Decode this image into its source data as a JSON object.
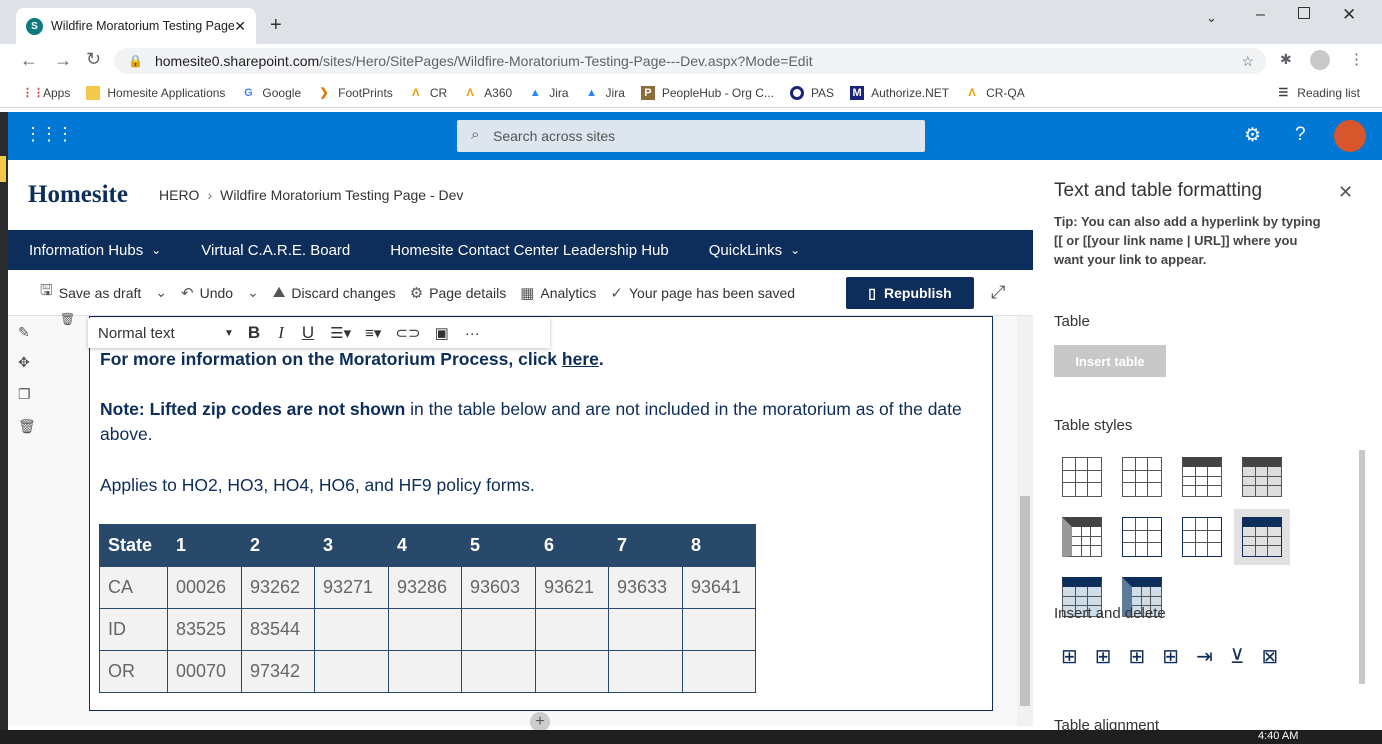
{
  "browser": {
    "tab_title": "Wildfire Moratorium Testing Page",
    "url_host": "homesite0.sharepoint.com",
    "url_path": "/sites/Hero/SitePages/Wildfire-Moratorium-Testing-Page---Dev.aspx?Mode=Edit"
  },
  "bookmarks": [
    "Apps",
    "Homesite Applications",
    "Google",
    "FootPrints",
    "CR",
    "A360",
    "Jira",
    "Jira",
    "PeopleHub - Org C...",
    "PAS",
    "Authorize.NET",
    "CR-QA"
  ],
  "reading_list": "Reading list",
  "suite": {
    "search_placeholder": "Search across sites"
  },
  "header": {
    "logo": "Homesite",
    "crumb_root": "HERO",
    "crumb_page": "Wildfire Moratorium Testing Page - Dev"
  },
  "nav": [
    "Information Hubs",
    "Virtual C.A.R.E. Board",
    "Homesite Contact Center Leadership Hub",
    "QuickLinks"
  ],
  "cmdbar": {
    "save_draft": "Save as draft",
    "undo": "Undo",
    "discard": "Discard changes",
    "details": "Page details",
    "analytics": "Analytics",
    "saved": "Your page has been saved",
    "republish": "Republish"
  },
  "rte": {
    "style": "Normal text"
  },
  "content": {
    "line1": "For more information on the Moratorium Process, click ",
    "link": "here",
    "line1end": ".",
    "note_bold": "Note: Lifted zip codes are not shown",
    "note_rest": " in the table below and are not included in the moratorium as of the date above.",
    "applies": "Applies to HO2, HO3, HO4, HO6, and HF9 policy forms."
  },
  "table": {
    "headers": [
      "State",
      "1",
      "2",
      "3",
      "4",
      "5",
      "6",
      "7",
      "8"
    ],
    "rows": [
      [
        "CA",
        "00026",
        "93262",
        "93271",
        "93286",
        "93603",
        "93621",
        "93633",
        "93641"
      ],
      [
        "ID",
        "83525",
        "83544",
        "",
        "",
        "",
        "",
        "",
        ""
      ],
      [
        "OR",
        "00070",
        "97342",
        "",
        "",
        "",
        "",
        "",
        ""
      ]
    ]
  },
  "panel": {
    "title": "Text and table formatting",
    "tip": "Tip: You can also add a hyperlink by typing [[ or [[your link name | URL]] where you want your link to appear.",
    "table": "Table",
    "insert_table": "Insert table",
    "styles": "Table styles",
    "insert_delete": "Insert and delete",
    "alignment": "Table alignment"
  },
  "clock": "4:40 AM"
}
